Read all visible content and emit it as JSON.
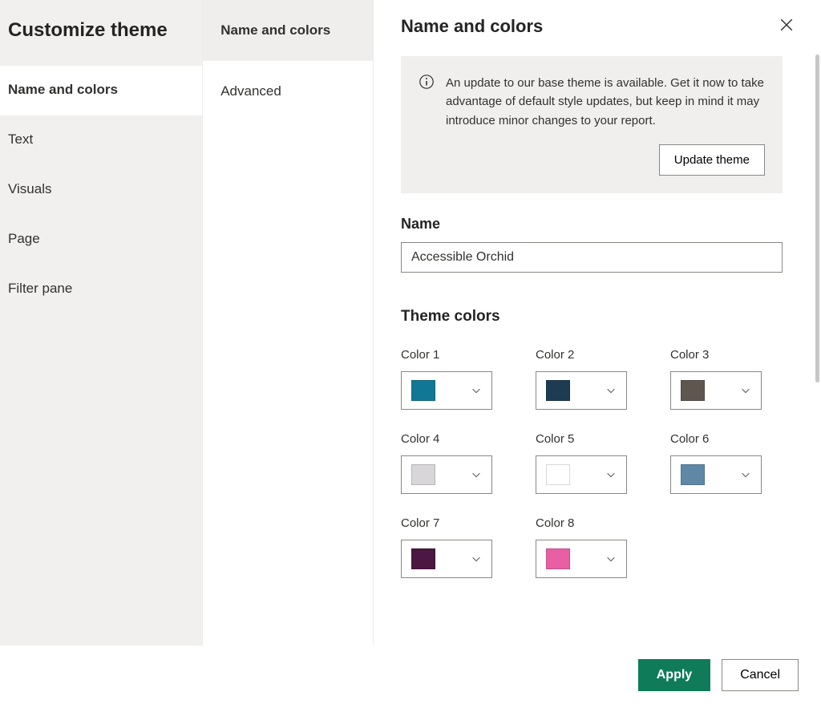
{
  "dialogTitle": "Customize theme",
  "primaryNav": {
    "items": [
      {
        "label": "Name and colors"
      },
      {
        "label": "Text"
      },
      {
        "label": "Visuals"
      },
      {
        "label": "Page"
      },
      {
        "label": "Filter pane"
      }
    ],
    "activeIndex": 0
  },
  "subNav": {
    "items": [
      {
        "label": "Name and colors"
      },
      {
        "label": "Advanced"
      }
    ],
    "activeIndex": 0
  },
  "detail": {
    "title": "Name and colors",
    "notice": {
      "text": "An update to our base theme is available. Get it now to take advantage of default style updates, but keep in mind it may introduce minor changes to your report.",
      "buttonLabel": "Update theme"
    },
    "nameSection": {
      "label": "Name",
      "value": "Accessible Orchid"
    },
    "colorsSection": {
      "label": "Theme colors",
      "colors": [
        {
          "label": "Color 1",
          "hex": "#107896"
        },
        {
          "label": "Color 2",
          "hex": "#1d3c52"
        },
        {
          "label": "Color 3",
          "hex": "#5f5650"
        },
        {
          "label": "Color 4",
          "hex": "#d8d6d8"
        },
        {
          "label": "Color 5",
          "hex": "#ffffff"
        },
        {
          "label": "Color 6",
          "hex": "#5f87a6"
        },
        {
          "label": "Color 7",
          "hex": "#4a1840"
        },
        {
          "label": "Color 8",
          "hex": "#e85fa4"
        }
      ]
    }
  },
  "footer": {
    "applyLabel": "Apply",
    "cancelLabel": "Cancel"
  }
}
